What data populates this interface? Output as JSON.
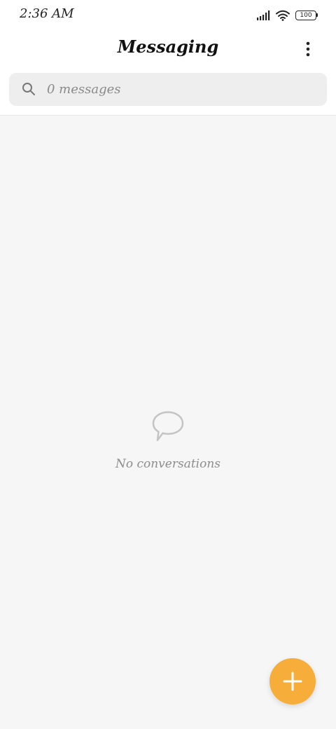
{
  "status_bar": {
    "time": "2:36 AM",
    "battery_level": "100",
    "icons": [
      "signal-icon",
      "wifi-icon",
      "battery-icon"
    ]
  },
  "header": {
    "title": "Messaging",
    "menu_icon": "more-vertical-icon"
  },
  "search": {
    "placeholder": "0 messages",
    "value": "",
    "icon": "search-icon"
  },
  "empty_state": {
    "icon": "chat-bubble-icon",
    "text": "No conversations"
  },
  "fab": {
    "icon": "plus-icon"
  },
  "colors": {
    "fab_background": "#f6ad3a",
    "page_background": "#f6f6f6",
    "header_background": "#ffffff",
    "search_background": "#eeeeee"
  }
}
